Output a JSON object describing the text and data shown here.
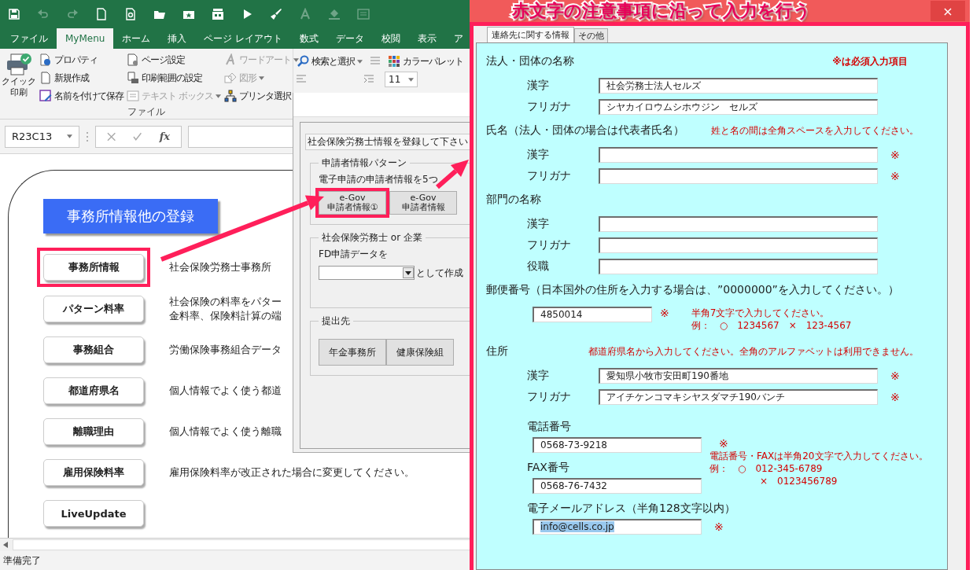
{
  "excel": {
    "quick_access": [
      {
        "kind": "save",
        "disabled": false
      },
      {
        "kind": "undo",
        "disabled": true
      },
      {
        "kind": "redo",
        "disabled": true
      },
      {
        "kind": "new",
        "disabled": false
      },
      {
        "kind": "preview",
        "disabled": false
      },
      {
        "kind": "open",
        "disabled": false
      },
      {
        "kind": "folder_star",
        "disabled": false
      },
      {
        "kind": "macro",
        "disabled": false
      },
      {
        "kind": "play",
        "disabled": false
      },
      {
        "kind": "brush",
        "disabled": false
      },
      {
        "kind": "font_color",
        "disabled": true
      },
      {
        "kind": "fill",
        "disabled": true
      },
      {
        "kind": "textbox",
        "disabled": true
      }
    ],
    "tabs": [
      {
        "label": "ファイル",
        "selected": false
      },
      {
        "label": "MyMenu",
        "selected": true
      },
      {
        "label": "ホーム",
        "selected": false
      },
      {
        "label": "挿入",
        "selected": false
      },
      {
        "label": "ページ レイアウト",
        "selected": false
      },
      {
        "label": "数式",
        "selected": false
      },
      {
        "label": "データ",
        "selected": false
      },
      {
        "label": "校閲",
        "selected": false
      },
      {
        "label": "表示",
        "selected": false
      },
      {
        "label": "ア",
        "selected": false
      }
    ],
    "ribbon": {
      "file_group": {
        "label": "ファイル",
        "big_button": "クイック印刷",
        "columns": [
          [
            {
              "label": "プロパティ",
              "kind": "properties",
              "disabled": false
            },
            {
              "label": "新規作成",
              "kind": "new",
              "disabled": false
            },
            {
              "label": "名前を付けて保存",
              "kind": "save_as",
              "disabled": false
            }
          ],
          [
            {
              "label": "ページ設定",
              "kind": "page_setup",
              "disabled": false
            },
            {
              "label": "印刷範囲の設定",
              "kind": "print_area",
              "disabled": false
            },
            {
              "label": "テキスト ボックス",
              "kind": "textbox",
              "disabled": true,
              "menu": true
            }
          ],
          [
            {
              "label": "ワードアート",
              "kind": "wordart",
              "disabled": true,
              "menu": true
            },
            {
              "label": "図形",
              "kind": "shapes",
              "disabled": true,
              "menu": true
            },
            {
              "label": "プリンタ選択",
              "kind": "printer_select",
              "disabled": false
            }
          ]
        ]
      },
      "edit_group": {
        "find": "検索と選択",
        "font_size": "11",
        "palette": "カラーパレット"
      }
    },
    "formula_bar": {
      "name_box": "R23C13",
      "function_label": "fx"
    },
    "sheet": {
      "title": "事務所情報他の登録",
      "buttons": [
        {
          "label": "事務所情報",
          "highlighted": true,
          "description": [
            "社会保険労務士事務所"
          ]
        },
        {
          "label": "パターン料率",
          "highlighted": false,
          "description": [
            "社会保険の料率をパター",
            "金料率、保険料計算の端"
          ]
        },
        {
          "label": "事務組合",
          "highlighted": false,
          "description": [
            "労働保険事務組合データ"
          ]
        },
        {
          "label": "都道府県名",
          "highlighted": false,
          "description": [
            "個人情報でよく使う都道"
          ]
        },
        {
          "label": "離職理由",
          "highlighted": false,
          "description": [
            "個人情報でよく使う離職"
          ]
        },
        {
          "label": "雇用保険料率",
          "highlighted": false,
          "description": [
            "雇用保険料率が改正された場合に変更してください。"
          ]
        },
        {
          "label": "LiveUpdate",
          "highlighted": false
        }
      ]
    },
    "status_bar": "準備完了"
  },
  "mid_dialog": {
    "prompt": "社会保険労務士情報を登録して下さい",
    "applicant_group": {
      "title": "申請者情報パターン",
      "text": "電子申請の申請者情報を5つ",
      "buttons": [
        {
          "lines": [
            "e-Gov",
            "申請者情報①"
          ],
          "highlighted": true
        },
        {
          "lines": [
            "e-Gov",
            "申請者情報"
          ],
          "highlighted": false
        }
      ]
    },
    "type_group": {
      "title": "社会保険労務士 or 企業",
      "label": "FD申請データを",
      "suffix": "として作成"
    },
    "destination_group": {
      "title": "提出先",
      "buttons": [
        "年金事務所",
        "健康保険組"
      ]
    }
  },
  "entry_dialog": {
    "annotation": "赤文字の注意事項に沿って入力を行う",
    "close": "×",
    "tabs": [
      {
        "label": "連絡先に関する情報",
        "selected": true
      },
      {
        "label": "その他",
        "selected": false
      }
    ],
    "rows": [
      {
        "kind": "heading",
        "text": "法人・団体の名称",
        "legend": "※は必須入力項目"
      },
      {
        "kind": "field",
        "label": "漢字",
        "value": "社会労務士法人セルズ"
      },
      {
        "kind": "field",
        "label": "フリガナ",
        "value": "シヤカイロウムシホウジン　セルズ"
      },
      {
        "kind": "heading",
        "text": "氏名（法人・団体の場合は代表者氏名）",
        "note": "姓と名の間は全角スペースを入力してください。"
      },
      {
        "kind": "field",
        "label": "漢字",
        "mark": "※"
      },
      {
        "kind": "field",
        "label": "フリガナ",
        "mark": "※"
      },
      {
        "kind": "heading",
        "text": "部門の名称"
      },
      {
        "kind": "field",
        "label": "漢字"
      },
      {
        "kind": "field",
        "label": "フリガナ"
      },
      {
        "kind": "field",
        "label": "役職"
      },
      {
        "kind": "heading",
        "text": "郵便番号（日本国外の住所を入力する場合は、”0000000”を入力してください。）"
      },
      {
        "kind": "postal",
        "value": "4850014",
        "mark": "※",
        "notes": [
          "半角7文字で入力してください。",
          "例：　○　1234567　×　123-4567"
        ]
      },
      {
        "kind": "heading",
        "text": "住所",
        "note": "都道府県名から入力してください。全角のアルファベットは利用できません。"
      },
      {
        "kind": "field",
        "label": "漢字",
        "value": "愛知県小牧市安田町190番地",
        "mark": "※"
      },
      {
        "kind": "field",
        "label": "フリガナ",
        "value": "アイチケンコマキシヤスダマチ190バンチ",
        "mark": "※"
      },
      {
        "kind": "phone",
        "fields": [
          {
            "label": "電話番号",
            "value": "0568-73-9218"
          },
          {
            "label": "FAX番号",
            "value": "0568-76-7432"
          }
        ],
        "mark": "※",
        "notes": [
          "電話番号・FAXは半角20文字で入力してください。",
          "例：　○　012-345-6789",
          "×　0123456789"
        ]
      },
      {
        "kind": "email",
        "label": "電子メールアドレス（半角128文字以内）",
        "value": "info@cells.co.jp",
        "selected": true,
        "mark": "※"
      }
    ]
  }
}
